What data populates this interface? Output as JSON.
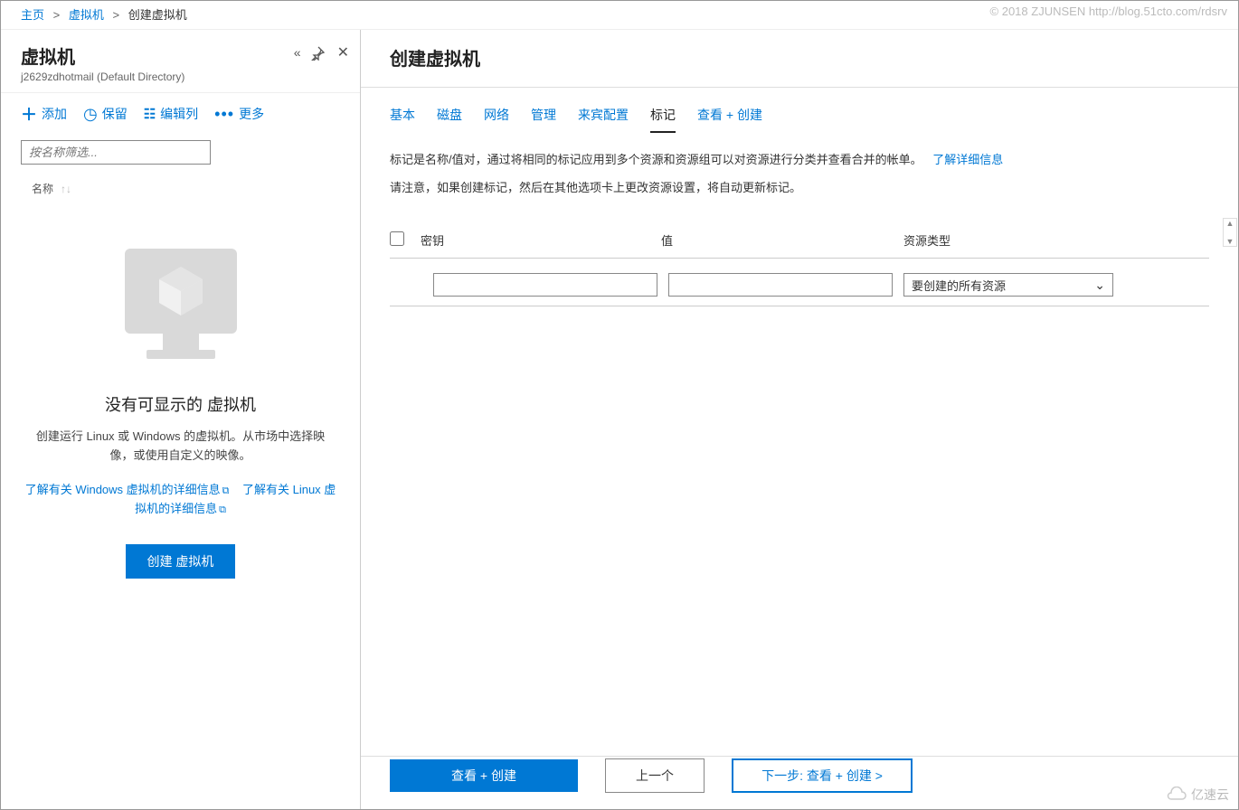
{
  "breadcrumb": {
    "home": "主页",
    "vm": "虚拟机",
    "current": "创建虚拟机"
  },
  "blade": {
    "title": "虚拟机",
    "subtitle": "j2629zdhotmail (Default Directory)",
    "toolbar": {
      "add": "添加",
      "keep": "保留",
      "editcol": "编辑列",
      "more": "更多"
    },
    "filter_placeholder": "按名称筛选...",
    "listcol": "名称",
    "empty": {
      "title": "没有可显示的 虚拟机",
      "desc": "创建运行 Linux 或 Windows 的虚拟机。从市场中选择映像，或使用自定义的映像。",
      "link1": "了解有关 Windows 虚拟机的详细信息",
      "link2": "了解有关 Linux 虚拟机的详细信息",
      "button": "创建 虚拟机"
    }
  },
  "main": {
    "title": "创建虚拟机",
    "tabs": {
      "basic": "基本",
      "disk": "磁盘",
      "network": "网络",
      "manage": "管理",
      "guest": "来宾配置",
      "tags": "标记",
      "review": "查看 + 创建"
    },
    "desc": {
      "line1": "标记是名称/值对，通过将相同的标记应用到多个资源和资源组可以对资源进行分类并查看合并的帐单。",
      "link": "了解详细信息",
      "line2": "请注意，如果创建标记，然后在其他选项卡上更改资源设置，将自动更新标记。"
    },
    "tagtable": {
      "key": "密钥",
      "value": "值",
      "restype": "资源类型",
      "dropdown": "要创建的所有资源"
    },
    "footer": {
      "review": "查看 + 创建",
      "prev": "上一个",
      "next": "下一步: 查看 + 创建 >"
    }
  },
  "watermark": "© 2018 ZJUNSEN http://blog.51cto.com/rdsrv",
  "brand": "亿速云"
}
